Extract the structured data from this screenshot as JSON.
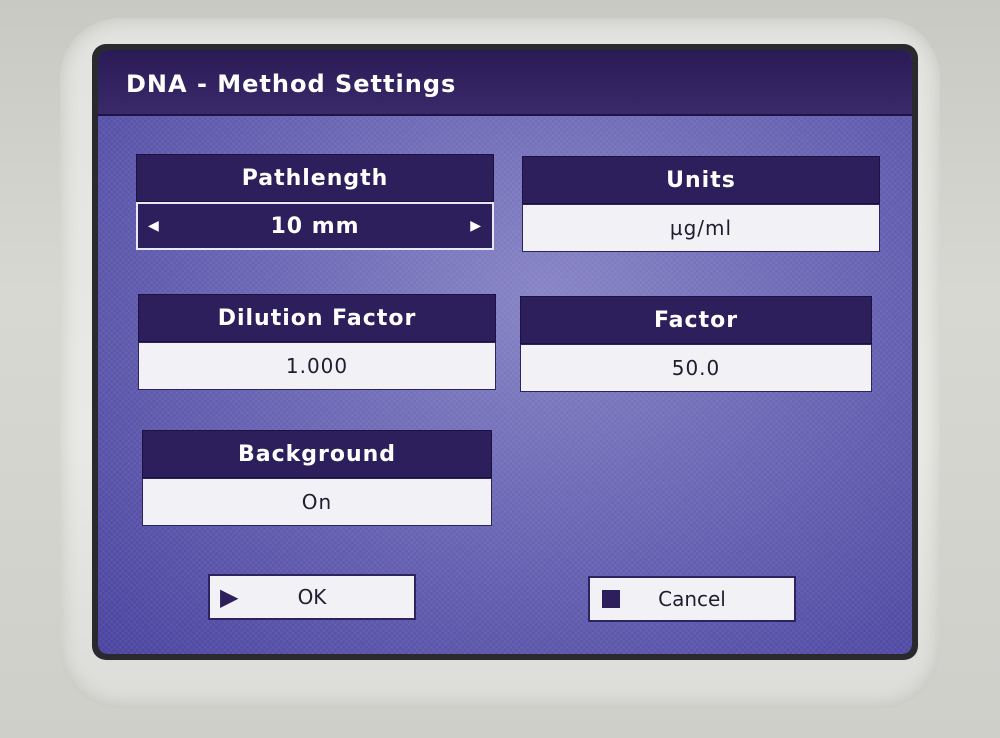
{
  "title": "DNA - Method Settings",
  "fields": {
    "pathlength": {
      "label": "Pathlength",
      "value": "10 mm"
    },
    "units": {
      "label": "Units",
      "value": "µg/ml"
    },
    "dilution_factor": {
      "label": "Dilution Factor",
      "value": "1.000"
    },
    "factor": {
      "label": "Factor",
      "value": "50.0"
    },
    "background": {
      "label": "Background",
      "value": "On"
    }
  },
  "buttons": {
    "ok": {
      "label": "OK",
      "icon": "play-icon"
    },
    "cancel": {
      "label": "Cancel",
      "icon": "stop-icon"
    }
  },
  "icons": {
    "left": "◀",
    "right": "▶",
    "play": "▶"
  },
  "colors": {
    "title_bar": "#2a1a55",
    "label_bg": "#2c1f5c",
    "value_bg": "#f2f2f6",
    "screen_bg": "#6b67b4"
  }
}
